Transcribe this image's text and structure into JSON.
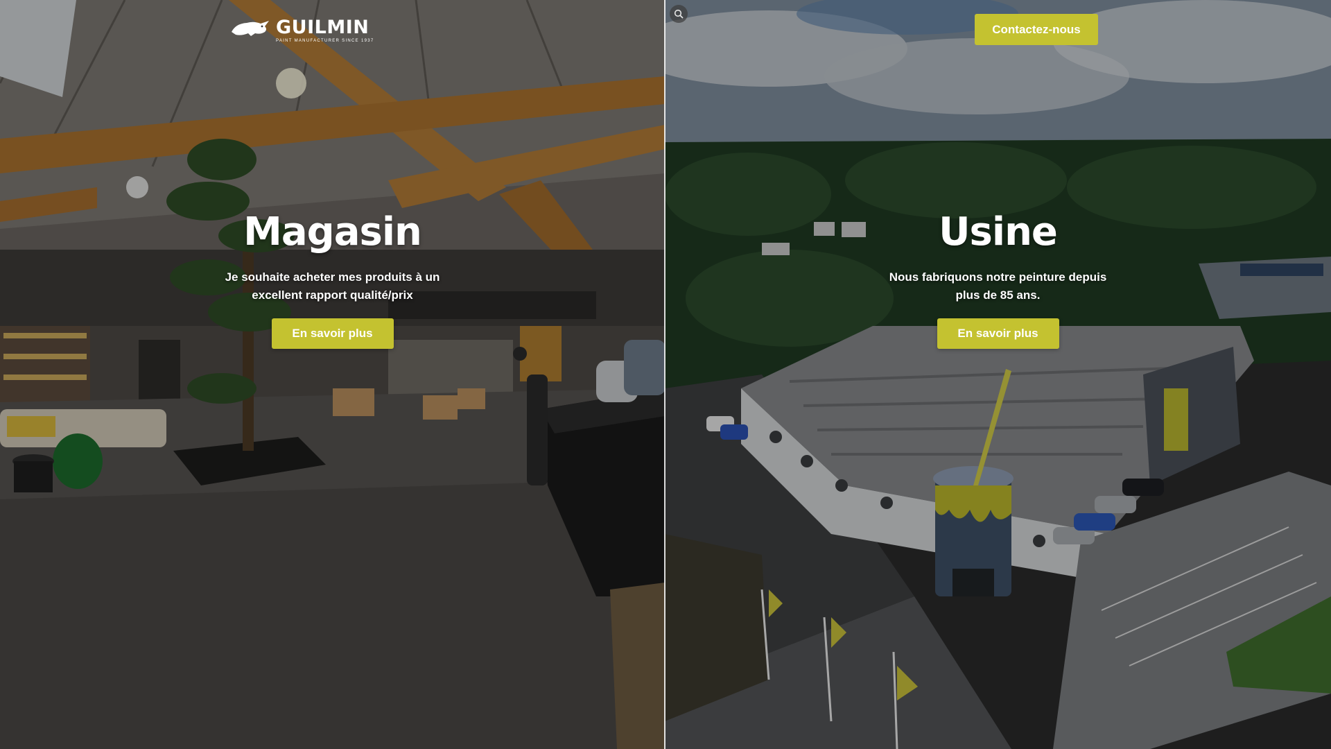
{
  "header": {
    "logo": {
      "brand": "GUILMIN",
      "tagline": "Paint manufacturer since 1937"
    },
    "search_icon": "search-icon",
    "contact_label": "Contactez-nous"
  },
  "panels": [
    {
      "title": "Magasin",
      "subtitle": "Je souhaite acheter mes produits à un excellent rapport qualité/prix",
      "cta": "En savoir plus"
    },
    {
      "title": "Usine",
      "subtitle": "Nous fabriquons notre peinture depuis plus de 85 ans.",
      "cta": "En savoir plus"
    }
  ],
  "colors": {
    "accent": "#c4c230",
    "text": "#ffffff",
    "overlay": "rgba(0,0,0,0.28)"
  }
}
